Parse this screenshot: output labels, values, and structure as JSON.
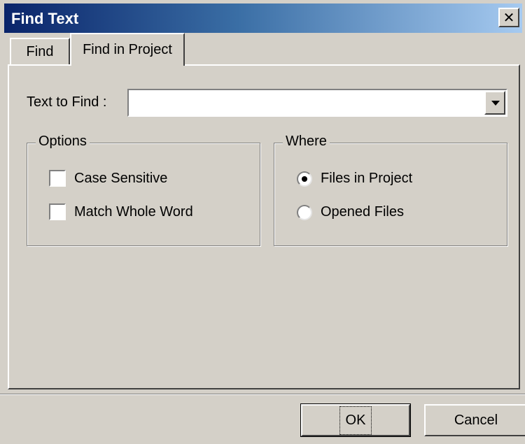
{
  "window": {
    "title": "Find Text"
  },
  "tabs": [
    {
      "label": "Find"
    },
    {
      "label": "Find in Project"
    }
  ],
  "active_tab": "Find in Project",
  "find": {
    "label": "Text to Find :",
    "value": ""
  },
  "options": {
    "title": "Options",
    "case_sensitive": {
      "label": "Case Sensitive",
      "checked": false
    },
    "match_whole_word": {
      "label": "Match Whole Word",
      "checked": false
    }
  },
  "where": {
    "title": "Where",
    "files_in_project": {
      "label": "Files in Project",
      "selected": true
    },
    "opened_files": {
      "label": "Opened Files",
      "selected": false
    }
  },
  "buttons": {
    "ok": "OK",
    "cancel": "Cancel"
  }
}
